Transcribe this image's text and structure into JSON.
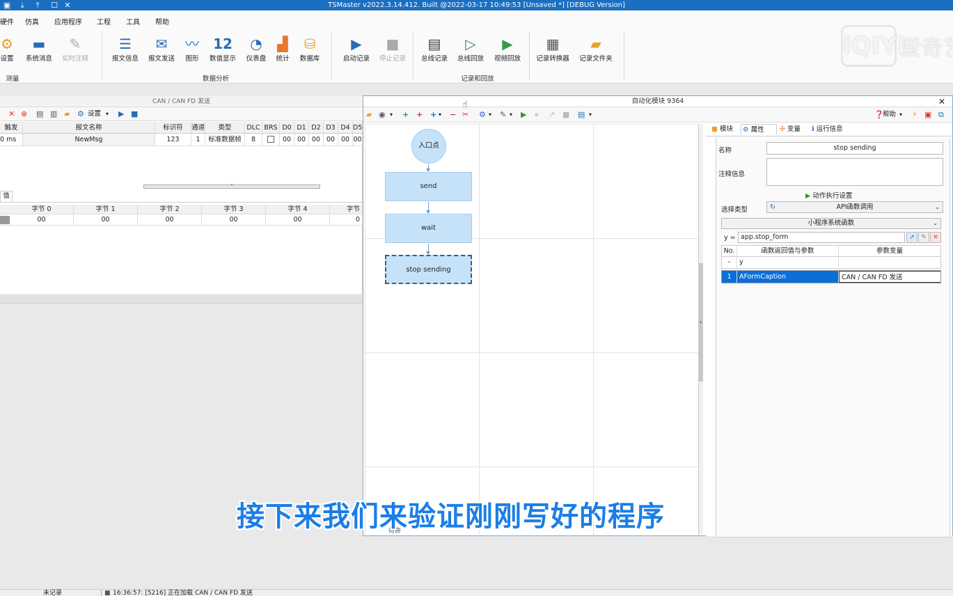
{
  "titlebar": {
    "title": "TSMaster v2022.3.14.412. Built @2022-03-17 10:49:53 [Unsaved *] [DEBUG Version]"
  },
  "menubar": {
    "items": [
      "硬件",
      "仿真",
      "应用程序",
      "工程",
      "工具",
      "帮助"
    ]
  },
  "ribbon": {
    "buttons": [
      {
        "label": "设置"
      },
      {
        "label": "系统消息"
      },
      {
        "label": "实时注释"
      },
      {
        "label": "报文信息"
      },
      {
        "label": "报文发送"
      },
      {
        "label": "图形"
      },
      {
        "label": "数值显示",
        "icon_text": "12"
      },
      {
        "label": "仪表盘"
      },
      {
        "label": "统计"
      },
      {
        "label": "数据库"
      },
      {
        "label": "启动记录"
      },
      {
        "label": "停止记录"
      },
      {
        "label": "总线记录"
      },
      {
        "label": "总线回放"
      },
      {
        "label": "视频回放"
      },
      {
        "label": "记录转换器"
      },
      {
        "label": "记录文件夹"
      }
    ],
    "groups": [
      "测量",
      "数据分析",
      "记录和回放"
    ]
  },
  "left_panel": {
    "caption": "CAN / CAN FD 发送",
    "toolbar_settings": "设置",
    "columns": [
      "触发",
      "报文名称",
      "标识符",
      "通道",
      "类型",
      "DLC",
      "BRS",
      "D0",
      "D1",
      "D2",
      "D3",
      "D4",
      "D5"
    ],
    "row": [
      "0 ms",
      "NewMsg",
      "123",
      "1",
      "标准数据帧",
      "8",
      "",
      "00",
      "00",
      "00",
      "00",
      "00",
      "00"
    ],
    "tab_label": "值",
    "byte_columns": [
      "字节 0",
      "字节 1",
      "字节 2",
      "字节 3",
      "字节 4",
      "字节"
    ],
    "byte_values": [
      "00",
      "00",
      "00",
      "00",
      "00",
      "0"
    ]
  },
  "automation": {
    "title": "自动化模块 9364",
    "help": "帮助",
    "nodes": [
      {
        "label": "入口点"
      },
      {
        "label": "send"
      },
      {
        "label": "wait"
      },
      {
        "label": "stop sending"
      }
    ],
    "tabs": [
      "模块",
      "属性",
      "变量",
      "运行信息"
    ],
    "props": {
      "name_label": "名称",
      "name_value": "stop sending",
      "comment_label": "注释信息",
      "action_settings": "动作执行设置",
      "select_type_label": "选择类型",
      "select_type_value": "API函数调用",
      "function_group": "小程序系统函数",
      "y_label": "y =",
      "expression": "app.stop_form",
      "table_headers": [
        "No.",
        "函数返回值与参数",
        "参数变量"
      ],
      "rows": [
        {
          "no": "-",
          "param": "y",
          "var": ""
        },
        {
          "no": "1",
          "param": "AFormCaption",
          "var": "CAN / CAN FD 发送"
        }
      ]
    },
    "bottom_label": "待命"
  },
  "subtitle": "接下来我们来验证刚刚写好的程序",
  "statusbar": {
    "left": "未记录",
    "message": "16:36:57: [5216] 正在加载 CAN / CAN FD 发送"
  },
  "watermark": {
    "logo": "iQIYI",
    "text": "爱奇艺"
  },
  "colors": {
    "accent": "#1a6fc2",
    "subtitle": "#1b7ee6",
    "node": "#c6e2f9",
    "selected_row": "#0a6fd8"
  }
}
